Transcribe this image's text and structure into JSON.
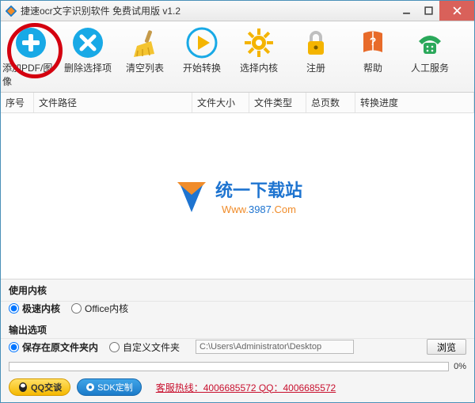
{
  "window": {
    "title": "捷速ocr文字识别软件 免费试用版 v1.2"
  },
  "toolbar": {
    "add": "添加PDF/图像",
    "del": "删除选择项",
    "clear": "清空列表",
    "start": "开始转换",
    "kernel": "选择内核",
    "register": "注册",
    "help": "帮助",
    "service": "人工服务"
  },
  "columns": {
    "index": "序号",
    "path": "文件路径",
    "size": "文件大小",
    "type": "文件类型",
    "pages": "总页数",
    "progress": "转换进度"
  },
  "watermark": {
    "name": "统一下载站",
    "url": "Www.3987.Com"
  },
  "kernel_panel": {
    "label": "使用内核",
    "fast": "极速内核",
    "office": "Office内核"
  },
  "output_panel": {
    "label": "输出选项",
    "save_src": "保存在原文件夹内",
    "custom": "自定义文件夹",
    "path": "C:\\Users\\Administrator\\Desktop",
    "browse": "浏览"
  },
  "progress": {
    "pct": "0%"
  },
  "footer": {
    "qq": "QQ交谈",
    "sdk": "SDK定制",
    "hotline": "客服热线：4006685572 QQ：4006685572"
  },
  "colors": {
    "accent": "#18a9e6",
    "ring": "#d4000f",
    "hotline": "#c8102e"
  }
}
